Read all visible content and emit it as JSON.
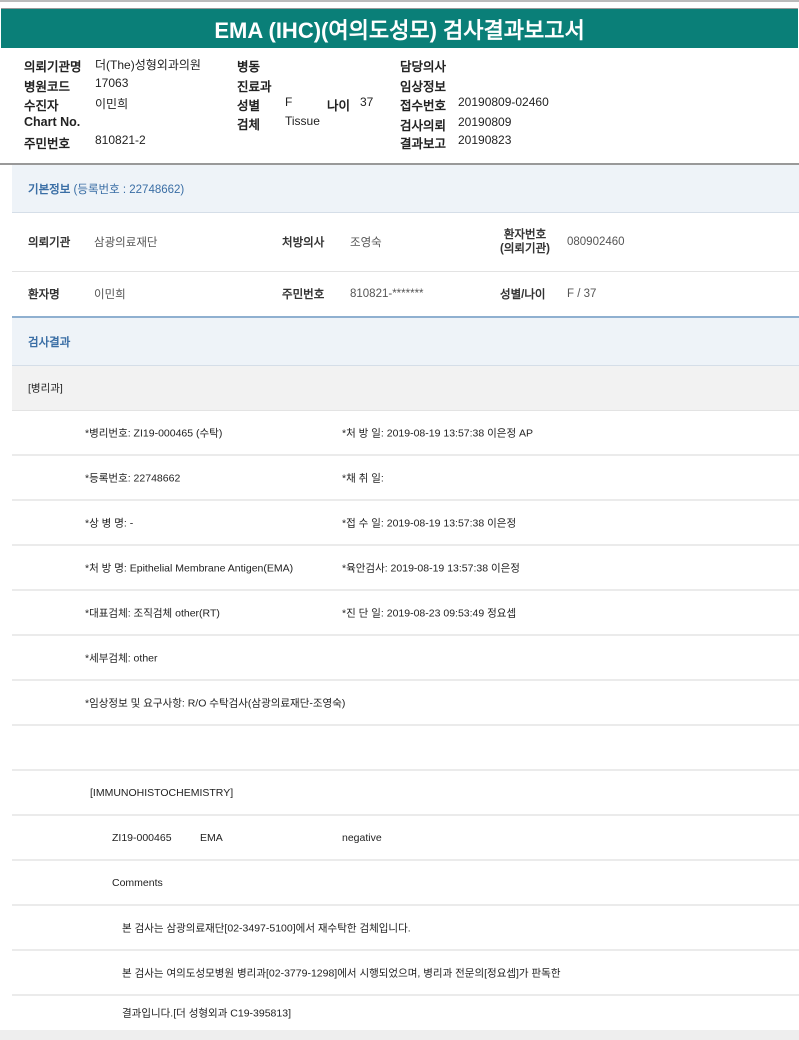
{
  "title": "EMA (IHC)(여의도성모) 검사결과보고서",
  "header": {
    "col1": [
      {
        "label": "의뢰기관명",
        "value": "더(The)성형외과의원"
      },
      {
        "label": "병원코드",
        "value": "17063"
      },
      {
        "label": "수진자",
        "value": "이민희"
      },
      {
        "label": "Chart No.",
        "value": ""
      },
      {
        "label": "주민번호",
        "value": "810821-2"
      }
    ],
    "col2": [
      {
        "label": "병동",
        "value": ""
      },
      {
        "label": "진료과",
        "value": ""
      },
      {
        "label": "성별",
        "value": "F"
      },
      {
        "label": "검체",
        "value": "Tissue"
      }
    ],
    "age": {
      "label": "나이",
      "value": "37"
    },
    "col3": [
      {
        "label": "담당의사",
        "value": ""
      },
      {
        "label": "임상정보",
        "value": ""
      },
      {
        "label": "접수번호",
        "value": "20190809-02460"
      },
      {
        "label": "검사의뢰",
        "value": "20190809"
      },
      {
        "label": "결과보고",
        "value": "20190823"
      }
    ]
  },
  "basic_info": {
    "title": "기본정보",
    "reg_no": "(등록번호 : 22748662)",
    "rows": [
      [
        {
          "label": "의뢰기관",
          "value": "삼광의료재단"
        },
        {
          "label": "처방의사",
          "value": "조영숙"
        },
        {
          "label": "환자번호",
          "label2": "(의뢰기관)",
          "value": "080902460"
        }
      ],
      [
        {
          "label": "환자명",
          "value": "이민희"
        },
        {
          "label": "주민번호",
          "value": "810821-*******"
        },
        {
          "label": "성별/나이",
          "value": "F / 37"
        }
      ]
    ]
  },
  "results": {
    "title": "검사결과",
    "department": "[병리과]",
    "rows": [
      [
        "*병리번호: ZI19-000465 (수탁)",
        "*처 방 일: 2019-08-19 13:57:38  이은정 AP"
      ],
      [
        "*등록번호: 22748662",
        "*채 취 일:"
      ],
      [
        "*상 병 명: -",
        "*접 수 일: 2019-08-19 13:57:38  이은정"
      ],
      [
        "*처 방 명: Epithelial Membrane Antigen(EMA)",
        "*육안검사: 2019-08-19 13:57:38  이은정"
      ],
      [
        "*대표검체: 조직검체 other(RT)",
        "*진 단 일: 2019-08-23 09:53:49  정요셉"
      ],
      [
        "*세부검체: other",
        ""
      ],
      [
        "*임상정보 및 요구사항: R/O 수탁검사(삼광의료재단-조영숙)",
        ""
      ]
    ],
    "ihc_header": "[IMMUNOHISTOCHEMISTRY]",
    "ihc": {
      "id": "ZI19-000465",
      "marker": "EMA",
      "result": "negative"
    },
    "comments_label": "Comments",
    "comments": [
      "본 검사는 삼광의료재단[02-3497-5100]에서 재수탁한 검체입니다.",
      "본 검사는 여의도성모병원 병리과[02-3779-1298]에서 시행되었으며, 병리과 전문의[정요셉]가 판독한",
      "결과입니다.[더 성형외과 C19-395813]"
    ]
  }
}
